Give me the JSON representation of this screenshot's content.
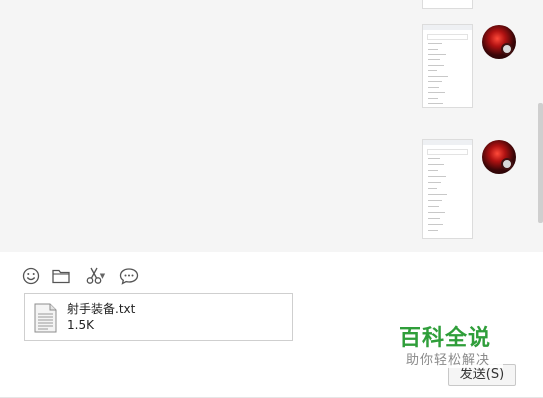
{
  "composer": {
    "toolbar": [
      {
        "name": "emoji-icon"
      },
      {
        "name": "folder-icon"
      },
      {
        "name": "scissors-icon"
      },
      {
        "name": "chat-bubble-icon"
      }
    ],
    "attachment": {
      "file_name": "射手装备.txt",
      "file_size": "1.5K"
    },
    "send_label": "发送(S)"
  },
  "watermark": {
    "title": "百科全说",
    "subtitle": "助你轻松解决"
  },
  "colors": {
    "history_bg": "#f5f5f5",
    "watermark_green": "#2f9e3a"
  }
}
